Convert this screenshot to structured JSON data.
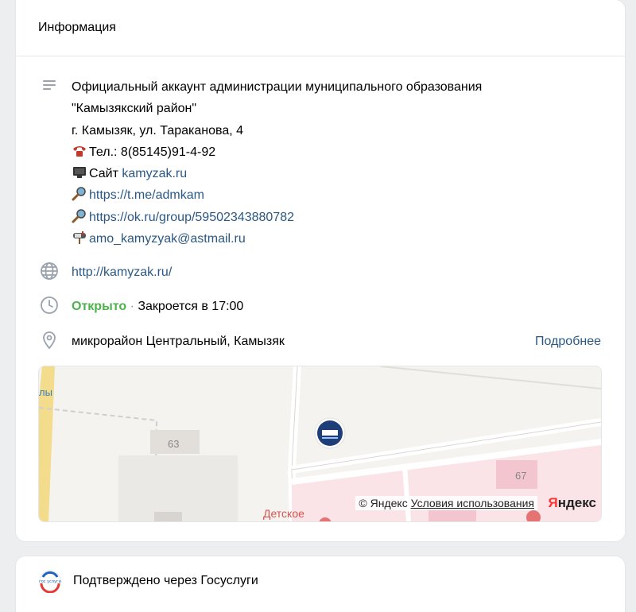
{
  "info_card": {
    "title": "Информация",
    "description": {
      "line1": "Официальный аккаунт администрации муниципального образования",
      "line2": "\"Камызякский район\"",
      "line3": "г. Камызяк, ул. Тараканова, 4",
      "phone": "Тел.: 8(85145)91-4-92",
      "site_prefix": "Сайт ",
      "site_link": "kamyzak.ru",
      "tg_link": "https://t.me/admkam",
      "ok_link": "https://ok.ru/group/59502343880782",
      "email_link": "amo_kamyzyak@astmail.ru"
    },
    "website": "http://kamyzak.ru/",
    "hours": {
      "status": "Открыто",
      "separator": "·",
      "closes": "Закроется в 17:00"
    },
    "address": {
      "text": "микрорайон Центральный, Камызяк",
      "more_label": "Подробнее"
    },
    "map": {
      "label_left": "лы",
      "label_63": "63",
      "label_67": "67",
      "label_detskoe": "Детское",
      "copyright": "© Яндекс ",
      "terms": "Условия использования",
      "logo_y": "Я",
      "logo_rest": "ндекс"
    }
  },
  "gos_card": {
    "text": "Подтверждено через Госуслуги",
    "logo_text": "гос услуги"
  },
  "icons": {
    "description": "text-lines-icon",
    "website": "globe-icon",
    "hours": "clock-icon",
    "address": "location-pin-icon",
    "phone": "phone-emoji-icon",
    "computer": "computer-emoji-icon",
    "magnifier": "magnifier-emoji-icon",
    "mailbox": "mailbox-emoji-icon"
  },
  "colors": {
    "link": "#2a5885",
    "open": "#4bb34b",
    "icon": "#99a2ad"
  }
}
